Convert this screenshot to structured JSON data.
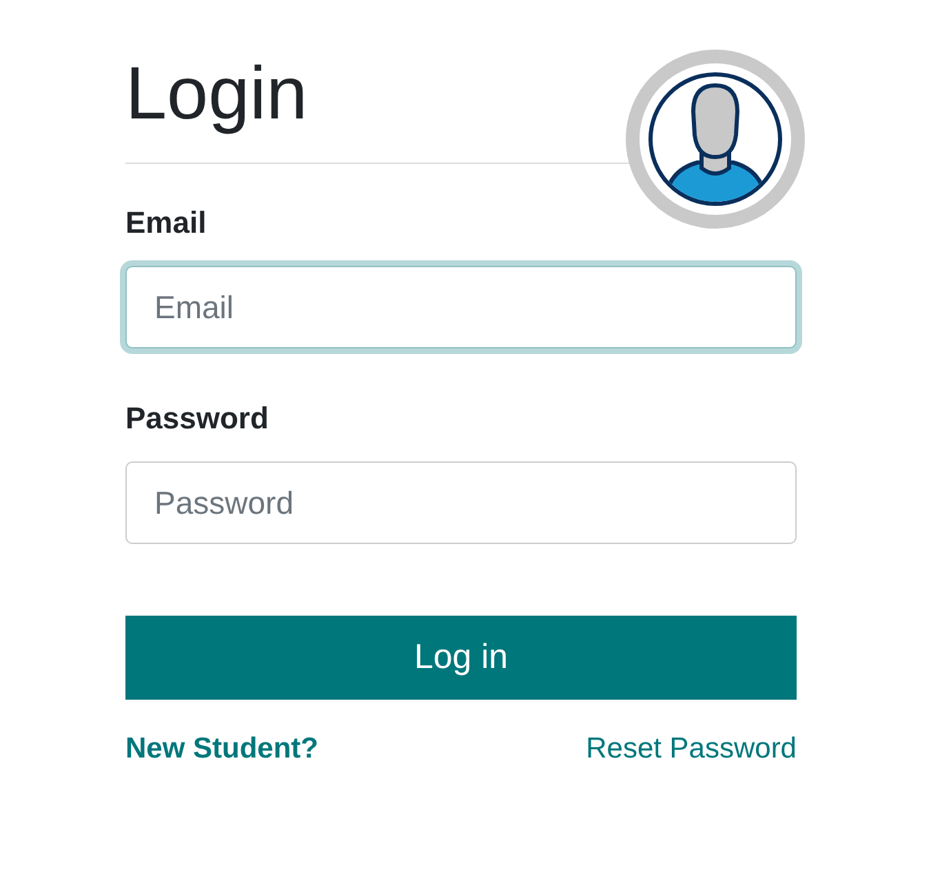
{
  "title": "Login",
  "fields": [
    {
      "label": "Email",
      "placeholder": "Email",
      "focused": true
    },
    {
      "label": "Password",
      "placeholder": "Password",
      "focused": false
    }
  ],
  "submit": "Log in",
  "links": [
    {
      "label": "New Student?",
      "kind": "bold"
    },
    {
      "label": "Reset Password",
      "kind": "plain"
    }
  ]
}
